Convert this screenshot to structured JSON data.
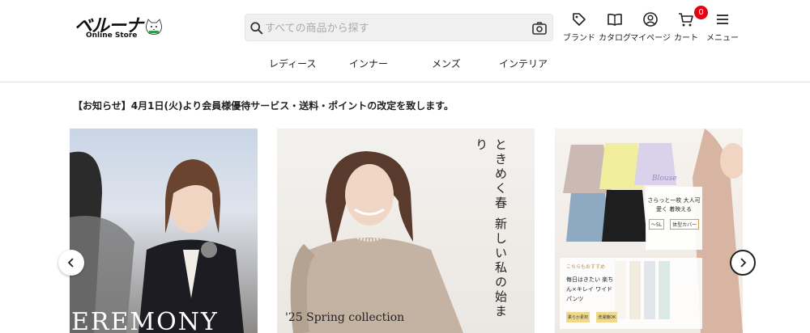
{
  "logo": {
    "brand": "ベルーナ",
    "sub": "Online Store"
  },
  "search": {
    "placeholder": "すべての商品から探す",
    "value": ""
  },
  "header_nav": [
    {
      "label": "ブランド",
      "icon": "tag-icon"
    },
    {
      "label": "カタログ",
      "icon": "book-icon"
    },
    {
      "label": "マイページ",
      "icon": "user-icon"
    },
    {
      "label": "カート",
      "icon": "cart-icon",
      "badge": "0"
    },
    {
      "label": "メニュー",
      "icon": "menu-icon"
    }
  ],
  "categories": [
    "レディース",
    "インナー",
    "メンズ",
    "インテリア"
  ],
  "notice": "【お知らせ】4月1日(火)より会員様優待サービス・送料・ポイントの改定を致します。",
  "banners": [
    {
      "text": "EREMONY"
    },
    {
      "copy": "ときめく春 新しい私の始まり",
      "collection": "'25 Spring collection"
    },
    {
      "script": "Blouse",
      "promo_title": "さらっと一枚 大人可愛く 着映える",
      "chips": [
        "〜5L",
        "体型カバー"
      ],
      "recommend": "こちらもおすすめ",
      "promo2": "毎日はきたい 楽ちん×キレイ ワイドパンツ",
      "chips2": [
        "柔らか素材",
        "洗濯機OK"
      ]
    }
  ],
  "colors": {
    "accent": "#e60012",
    "text": "#222222",
    "search_bg": "#f0f0f0"
  }
}
